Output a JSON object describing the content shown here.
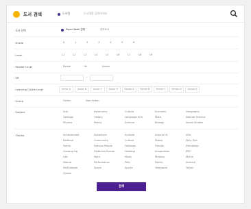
{
  "header": {
    "title": "도서 검색",
    "mode": "도서명",
    "search_placeholder": "도서명을 입력하세요"
  },
  "booktype": {
    "label": "· 도서 선택",
    "opts": [
      "Paper Book 전체",
      "전자도서"
    ]
  },
  "grade": {
    "label": "· Grade",
    "opts": [
      "K",
      "1",
      "2",
      "3",
      "4",
      "5",
      "6"
    ]
  },
  "level": {
    "label": "· Level",
    "opts": [
      "L1",
      "L2",
      "L3",
      "L4",
      "L5",
      "L6",
      "L7",
      "L8",
      "L9"
    ]
  },
  "reader": {
    "label": "· Reader Level",
    "opts": [
      "Below",
      "At",
      "Above"
    ]
  },
  "ar": {
    "label": "· AR",
    "sep": "~"
  },
  "lcl": {
    "label": "· Learning Castle Level",
    "opts": [
      "Junior A",
      "Junior B",
      "Junior C",
      "Junior D",
      "Senior A",
      "Senior B",
      "Senior C",
      "Senior D",
      "Senior E"
    ]
  },
  "genre": {
    "label": "· Genre",
    "opts": [
      "Fiction",
      "Non-fiction"
    ]
  },
  "subject": {
    "label": "· Subject",
    "opts": [
      "Arts",
      "Astronomy",
      "Culture",
      "Economy",
      "Geography",
      "Geology",
      "History",
      "Language Arts",
      "Math",
      "Natural Science",
      "Physics",
      "Poetry",
      "Science",
      "Biology",
      "Social Studies"
    ]
  },
  "theme": {
    "label": "· Theme",
    "opts": [
      "Achievement",
      "Adventure",
      "Animals",
      "Around Us",
      "Arts",
      "Bedtime",
      "Community",
      "Culture",
      "Fables",
      "Fairy Tale",
      "Family",
      "Famous People",
      "Folktales",
      "Friends",
      "Friendship",
      "Growing Up",
      "Historical Events",
      "Holidays",
      "Imagination",
      "ESC",
      "Life",
      "Math",
      "Music",
      "Mystery",
      "Myths",
      "Nature",
      "Performance",
      "Pets",
      "Poetry",
      "Science",
      "Self-Esteem",
      "Space",
      "Sports",
      "Teamwork",
      "Travel",
      "Classic"
    ]
  },
  "submit": {
    "label": "검색"
  }
}
